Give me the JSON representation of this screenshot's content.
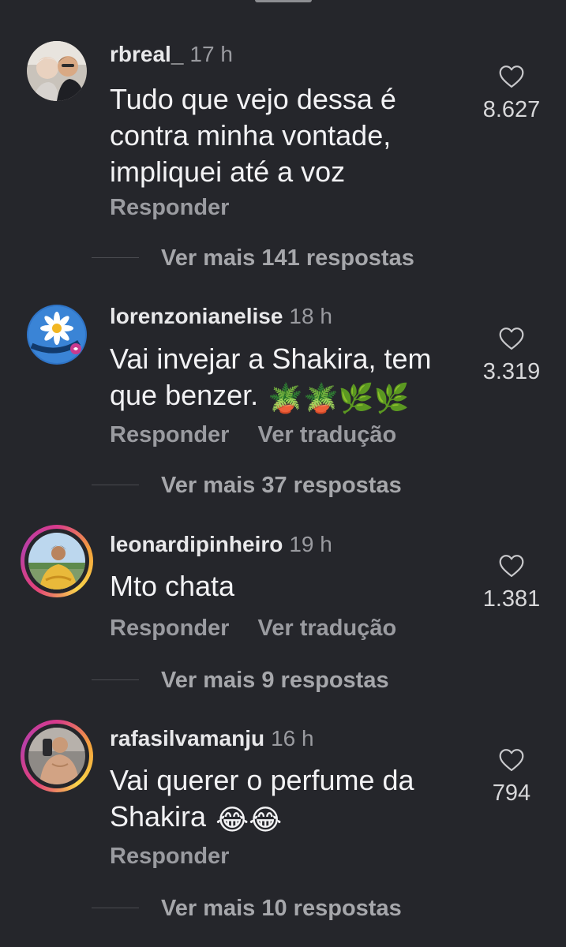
{
  "comments": [
    {
      "username": "rbreal_",
      "time": "17 h",
      "text": "Tudo que vejo dessa é contra minha vontade, impliquei até a voz",
      "actions": [
        "Responder"
      ],
      "likes": "8.627",
      "more_replies": "Ver mais 141 respostas",
      "avatar_icon": "photo-avatar"
    },
    {
      "username": "lorenzonianelise",
      "time": "18 h",
      "text": "Vai invejar a Shakira, tem que benzer.",
      "text_emojis": "🪴🪴🌿🌿",
      "actions": [
        "Responder",
        "Ver tradução"
      ],
      "likes": "3.319",
      "more_replies": "Ver mais 37 respostas",
      "avatar_badge_text": "VAMOS NOS VACINAR",
      "avatar_icon": "daisy-avatar"
    },
    {
      "username": "leonardipinheiro",
      "time": "19 h",
      "text": "Mto chata",
      "actions": [
        "Responder",
        "Ver tradução"
      ],
      "likes": "1.381",
      "more_replies": "Ver mais 9 respostas",
      "avatar_icon": "story-ring-avatar"
    },
    {
      "username": "rafasilvamanju",
      "time": "16 h",
      "text": "Vai querer o perfume da Shakira",
      "text_emojis": "😂😂",
      "actions": [
        "Responder"
      ],
      "likes": "794",
      "more_replies": "Ver mais 10 respostas",
      "avatar_icon": "story-ring-avatar"
    }
  ],
  "colors": {
    "background": "#25262b",
    "secondary_text": "#9a9ba0",
    "primary_text": "#f2f2f4"
  }
}
